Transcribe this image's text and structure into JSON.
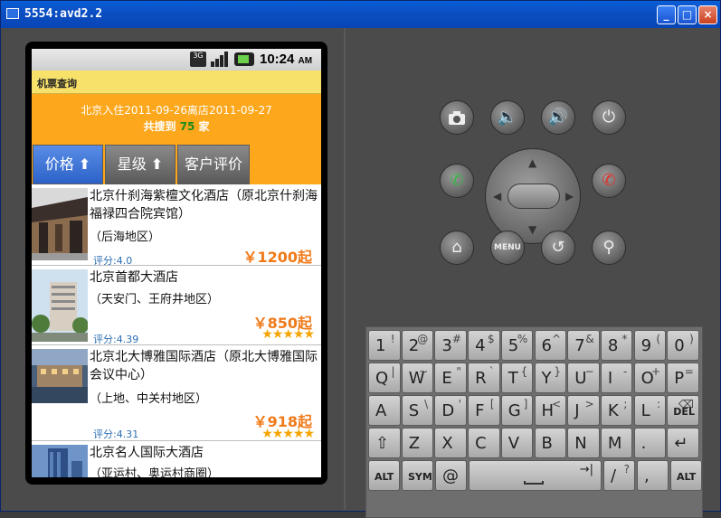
{
  "window": {
    "title": "5554:avd2.2",
    "min": "_",
    "max": "□",
    "close": "×"
  },
  "status": {
    "net": "3G",
    "time": "10:24",
    "ampm": "AM"
  },
  "app": {
    "title": "机票查询",
    "dates": "北京入住2011-09-26离店2011-09-27",
    "count_prefix": "共搜到",
    "count": "75",
    "count_suffix": "家"
  },
  "sort": {
    "price": "价格",
    "star": "星级",
    "review": "客户评价",
    "arrow": "⬆"
  },
  "hotels": [
    {
      "name": "北京什刹海紫檀文化酒店（原北京什刹海福禄四合院宾馆）",
      "area": "（后海地区）",
      "score": "评分:4.0",
      "price": "￥1200起",
      "stars": ""
    },
    {
      "name": "北京首都大酒店",
      "area": "（天安门、王府井地区）",
      "score": "评分:4.39",
      "price": "￥850起",
      "stars": "★★★★★"
    },
    {
      "name": "北京北大博雅国际酒店（原北大博雅国际会议中心）",
      "area": "（上地、中关村地区）",
      "score": "评分:4.31",
      "price": "￥918起",
      "stars": "★★★★★"
    },
    {
      "name": "北京名人国际大酒店",
      "area": "（亚运村、奥运村商圈）",
      "score": "",
      "price": "",
      "stars": ""
    }
  ],
  "controls": {
    "menu": "MENU"
  },
  "keyboard": {
    "row1": [
      [
        "1",
        "!"
      ],
      [
        "2",
        "@"
      ],
      [
        "3",
        "#"
      ],
      [
        "4",
        "$"
      ],
      [
        "5",
        "%"
      ],
      [
        "6",
        "^"
      ],
      [
        "7",
        "&"
      ],
      [
        "8",
        "*"
      ],
      [
        "9",
        "("
      ],
      [
        "0",
        ")"
      ]
    ],
    "row2": [
      [
        "Q",
        "|"
      ],
      [
        "W",
        "~"
      ],
      [
        "E",
        "\""
      ],
      [
        "R",
        "`"
      ],
      [
        "T",
        "{"
      ],
      [
        "Y",
        "}"
      ],
      [
        "U",
        "−"
      ],
      [
        "I",
        "-"
      ],
      [
        "O",
        "+"
      ],
      [
        "P",
        "="
      ]
    ],
    "row3": [
      [
        "A",
        ""
      ],
      [
        "S",
        "\\"
      ],
      [
        "D",
        "'"
      ],
      [
        "F",
        "["
      ],
      [
        "G",
        "]"
      ],
      [
        "H",
        "<"
      ],
      [
        "J",
        ">"
      ],
      [
        "K",
        ";"
      ],
      [
        "L",
        ":"
      ],
      [
        "DEL",
        "⌫"
      ]
    ],
    "row4": [
      [
        "⇧",
        ""
      ],
      [
        "Z",
        ""
      ],
      [
        "X",
        ""
      ],
      [
        "C",
        ""
      ],
      [
        "V",
        ""
      ],
      [
        "B",
        ""
      ],
      [
        "N",
        ""
      ],
      [
        "M",
        ""
      ],
      [
        ".",
        ""
      ],
      [
        "↵",
        ""
      ]
    ],
    "row5": {
      "alt": "ALT",
      "sym": "SYM",
      "at": "@",
      "tab": "→|",
      "slash": "/",
      "question": "?",
      "comma": ",",
      "alt2": "ALT"
    }
  }
}
